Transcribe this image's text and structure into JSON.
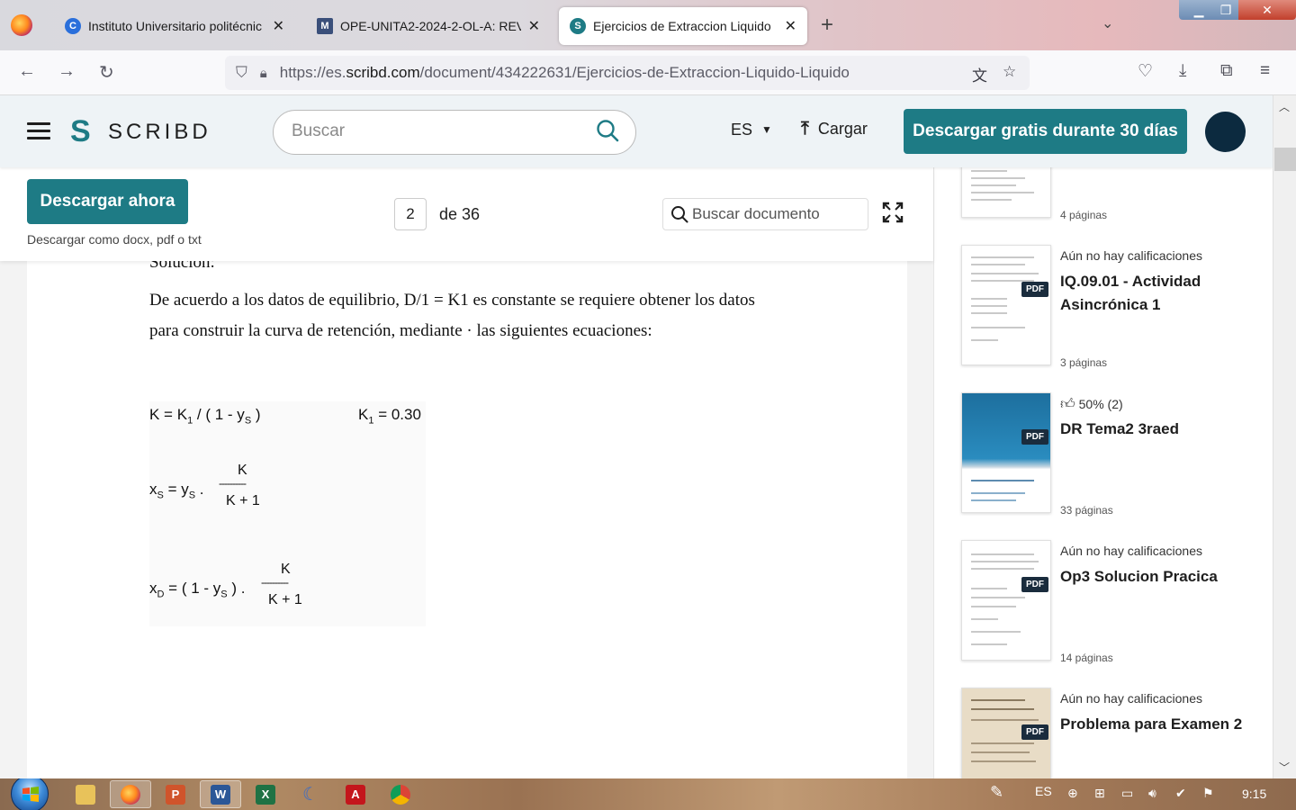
{
  "browser": {
    "tabs": [
      {
        "title": "Instituto Universitario politécnic",
        "active": false
      },
      {
        "title": "OPE-UNITA2-2024-2-OL-A: REV",
        "active": false
      },
      {
        "title": "Ejercicios de Extraccion Liquido",
        "active": true
      }
    ],
    "url_prefix": "https://es.",
    "url_domain": "scribd.com",
    "url_path": "/document/434222631/Ejercicios-de-Extraccion-Liquido-Liquido"
  },
  "header": {
    "logo_mark": "S",
    "logo_text": "SCRIBD",
    "search_placeholder": "Buscar",
    "language": "ES",
    "upload_label": "Cargar",
    "cta_label": "Descargar gratis durante 30 días"
  },
  "toolbar": {
    "download_now": "Descargar ahora",
    "download_sub": "Descargar como docx, pdf o txt",
    "page_current": "2",
    "page_total": "de 36",
    "doc_search_placeholder": "Buscar documento"
  },
  "document": {
    "prev_line": "Solución:",
    "para_line1": "De acuerdo a los datos de equilibrio, D/1 = K1 es constante se requiere obtener los datos",
    "para_line2": "para construir la curva de retención, mediante · las siguientes ecuaciones:",
    "eq1_left": "K = K",
    "eq1_sub": "1",
    "eq1_rest": " / ( 1 -  y",
    "eq1_sub2": "S",
    "eq1_close": " )",
    "eq1_const": "K",
    "eq1_const_sub": "1",
    "eq1_const_val": " = 0.30",
    "eq2_left": "x",
    "eq2_sub": "S",
    "eq2_mid": " =  y",
    "eq2_sub2": "S",
    "eq2_dot": "  .",
    "eq2_num": "K",
    "eq2_line": "----------",
    "eq2_den": "K + 1",
    "eq3_left": "x",
    "eq3_sub": "D",
    "eq3_mid": "  = ( 1 -  y",
    "eq3_sub2": "S",
    "eq3_close": " )  .",
    "eq3_num": "K",
    "eq3_line": "----------",
    "eq3_den": "K + 1"
  },
  "sidebar": {
    "items": [
      {
        "rating": "",
        "title": "",
        "pages": "4 páginas",
        "pdf": ""
      },
      {
        "rating": "Aún no hay calificaciones",
        "title": "IQ.09.01 - Actividad Asincrónica 1",
        "pages": "3 páginas",
        "pdf": "PDF"
      },
      {
        "rating": "50% (2)",
        "title": "DR Tema2 3raed",
        "pages": "33 páginas",
        "pdf": "PDF"
      },
      {
        "rating": "Aún no hay calificaciones",
        "title": "Op3 Solucion Pracica",
        "pages": "14 páginas",
        "pdf": "PDF"
      },
      {
        "rating": "Aún no hay calificaciones",
        "title": "Problema para Examen 2",
        "pages": "",
        "pdf": "PDF"
      }
    ]
  },
  "taskbar": {
    "lang": "ES",
    "clock": "9:15"
  },
  "colors": {
    "brand_teal": "#1e7b85",
    "avatar": "#0c2a3f"
  }
}
